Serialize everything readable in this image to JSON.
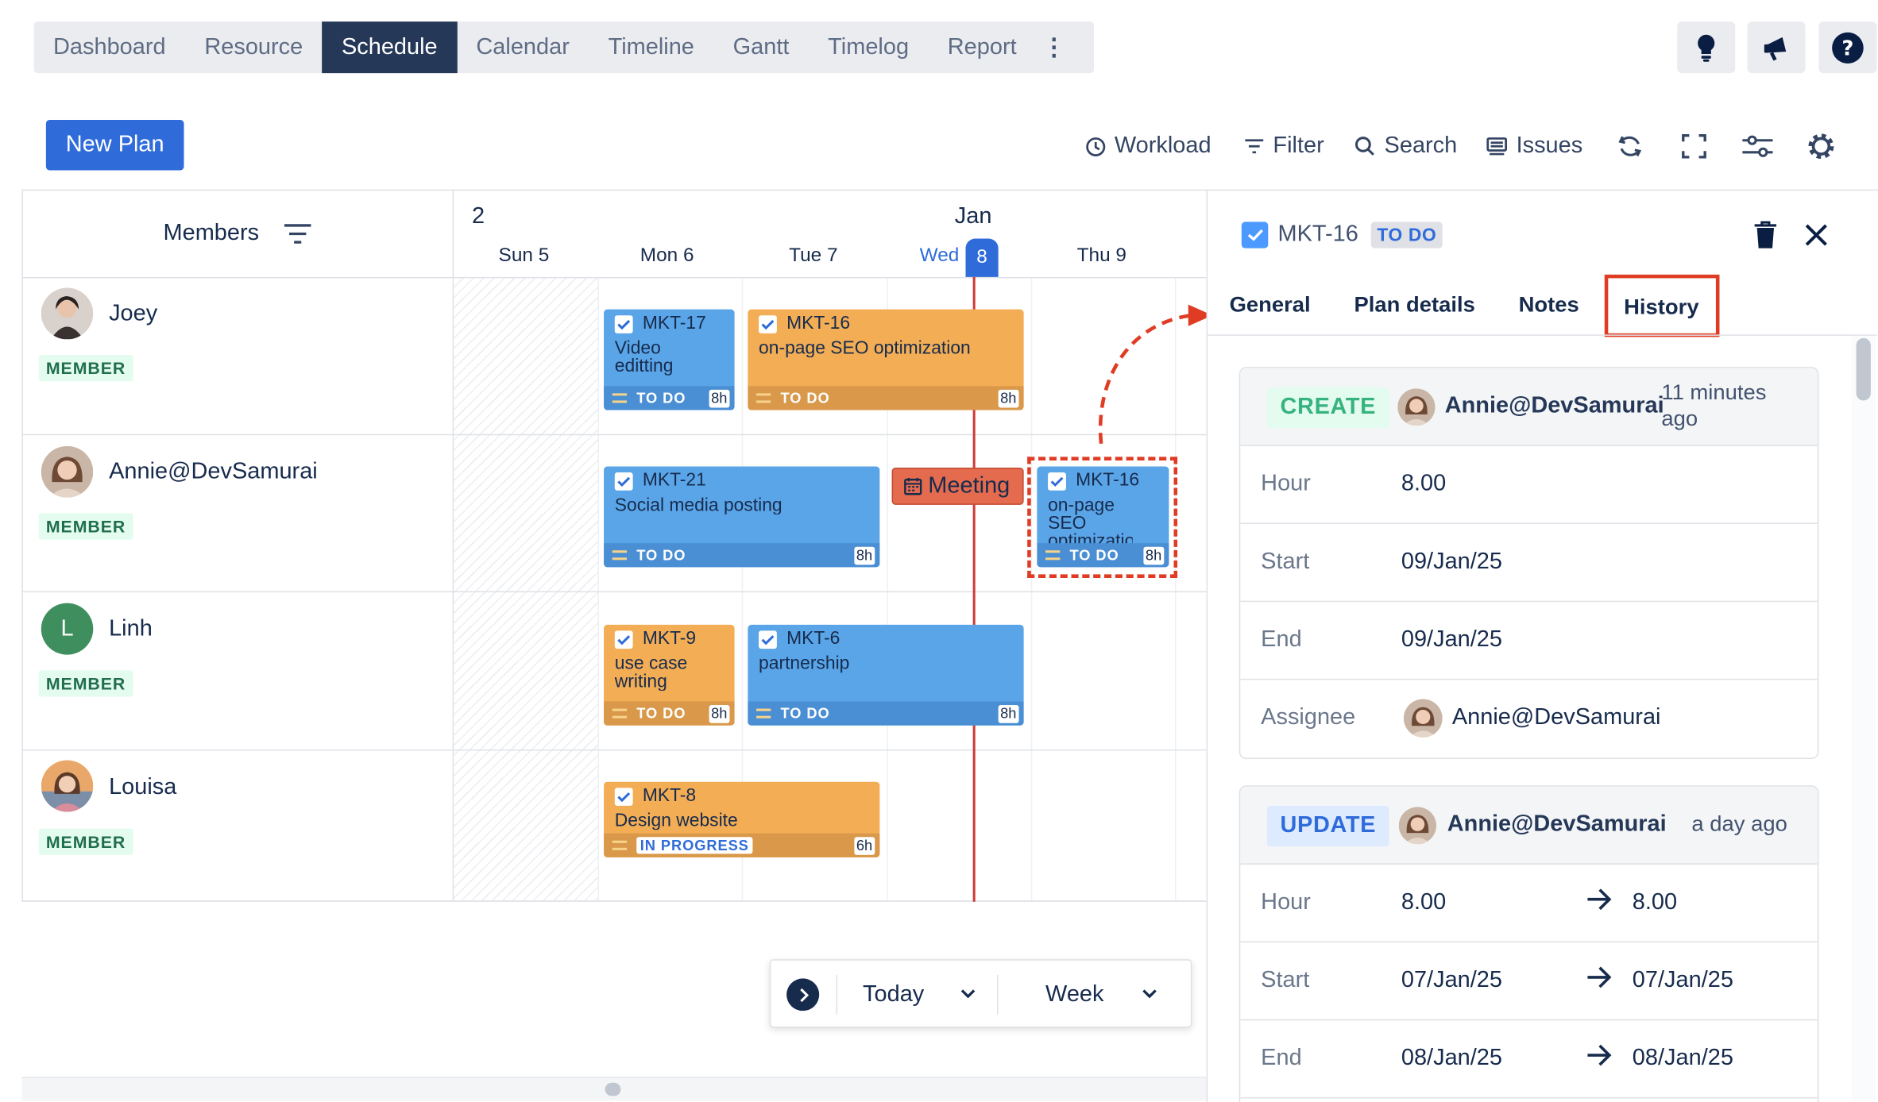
{
  "nav": {
    "tabs": [
      "Dashboard",
      "Resource",
      "Schedule",
      "Calendar",
      "Timeline",
      "Gantt",
      "Timelog",
      "Report"
    ],
    "active": "Schedule",
    "more_icon": "more-vertical-icon"
  },
  "header_icons": [
    "lightbulb-icon",
    "megaphone-icon",
    "help-icon"
  ],
  "toolbar": {
    "new_plan": "New Plan",
    "workload": "Workload",
    "filter": "Filter",
    "search": "Search",
    "issues": "Issues",
    "icons": [
      "refresh-icon",
      "fullscreen-icon",
      "sliders-icon",
      "settings-icon"
    ]
  },
  "grid": {
    "members_header": "Members",
    "week_start": "2",
    "month": "Jan",
    "days": [
      "Sun 5",
      "Mon 6",
      "Tue 7",
      "Wed",
      "Thu 9"
    ],
    "today_day": "Wed",
    "today_num": "8"
  },
  "members": [
    {
      "name": "Joey",
      "role": "MEMBER"
    },
    {
      "name": "Annie@DevSamurai",
      "role": "MEMBER"
    },
    {
      "name": "Linh",
      "role": "MEMBER",
      "initial": "L",
      "color": "#3e8e5e"
    },
    {
      "name": "Louisa",
      "role": "MEMBER"
    }
  ],
  "tasks": [
    {
      "key": "MKT-17",
      "title": "Video editting",
      "status": "TO DO",
      "hours": "8h",
      "color": "blue"
    },
    {
      "key": "MKT-16",
      "title": "on-page SEO optimization",
      "status": "TO DO",
      "hours": "8h",
      "color": "orange"
    },
    {
      "key": "MKT-21",
      "title": "Social media posting",
      "status": "TO DO",
      "hours": "8h",
      "color": "blue"
    },
    {
      "key": "MKT-16",
      "title": "on-page SEO optimization",
      "status": "TO DO",
      "hours": "8h",
      "color": "blue"
    },
    {
      "key": "MKT-9",
      "title": "use case writing",
      "status": "TO DO",
      "hours": "8h",
      "color": "orange"
    },
    {
      "key": "MKT-6",
      "title": "partnership",
      "status": "TO DO",
      "hours": "8h",
      "color": "blue"
    },
    {
      "key": "MKT-8",
      "title": "Design website",
      "status": "IN PROGRESS",
      "hours": "6h",
      "color": "orange"
    }
  ],
  "meeting": {
    "label": "Meeting",
    "icon": "calendar-icon"
  },
  "bottom": {
    "today": "Today",
    "week": "Week"
  },
  "panel": {
    "issue_key": "MKT-16",
    "issue_status": "TO DO",
    "tabs": [
      "General",
      "Plan details",
      "Notes",
      "History"
    ],
    "active_tab": "History",
    "history": [
      {
        "action": "CREATE",
        "user": "Annie@DevSamurai",
        "time": "11 minutes ago",
        "rows": [
          {
            "label": "Hour",
            "value": "8.00"
          },
          {
            "label": "Start",
            "value": "09/Jan/25"
          },
          {
            "label": "End",
            "value": "09/Jan/25"
          },
          {
            "label": "Assignee",
            "value": "Annie@DevSamurai"
          }
        ]
      },
      {
        "action": "UPDATE",
        "user": "Annie@DevSamurai",
        "time": "a day ago",
        "rows": [
          {
            "label": "Hour",
            "from": "8.00",
            "to": "8.00"
          },
          {
            "label": "Start",
            "from": "07/Jan/25",
            "to": "07/Jan/25"
          },
          {
            "label": "End",
            "from": "08/Jan/25",
            "to": "08/Jan/25"
          }
        ]
      }
    ]
  },
  "colors": {
    "accent": "#2f6cd9",
    "nav_active": "#253858",
    "today_line": "#d03b3b",
    "highlight": "#e03c24",
    "task_blue": "#5aa5e8",
    "task_orange": "#f2ad55"
  }
}
